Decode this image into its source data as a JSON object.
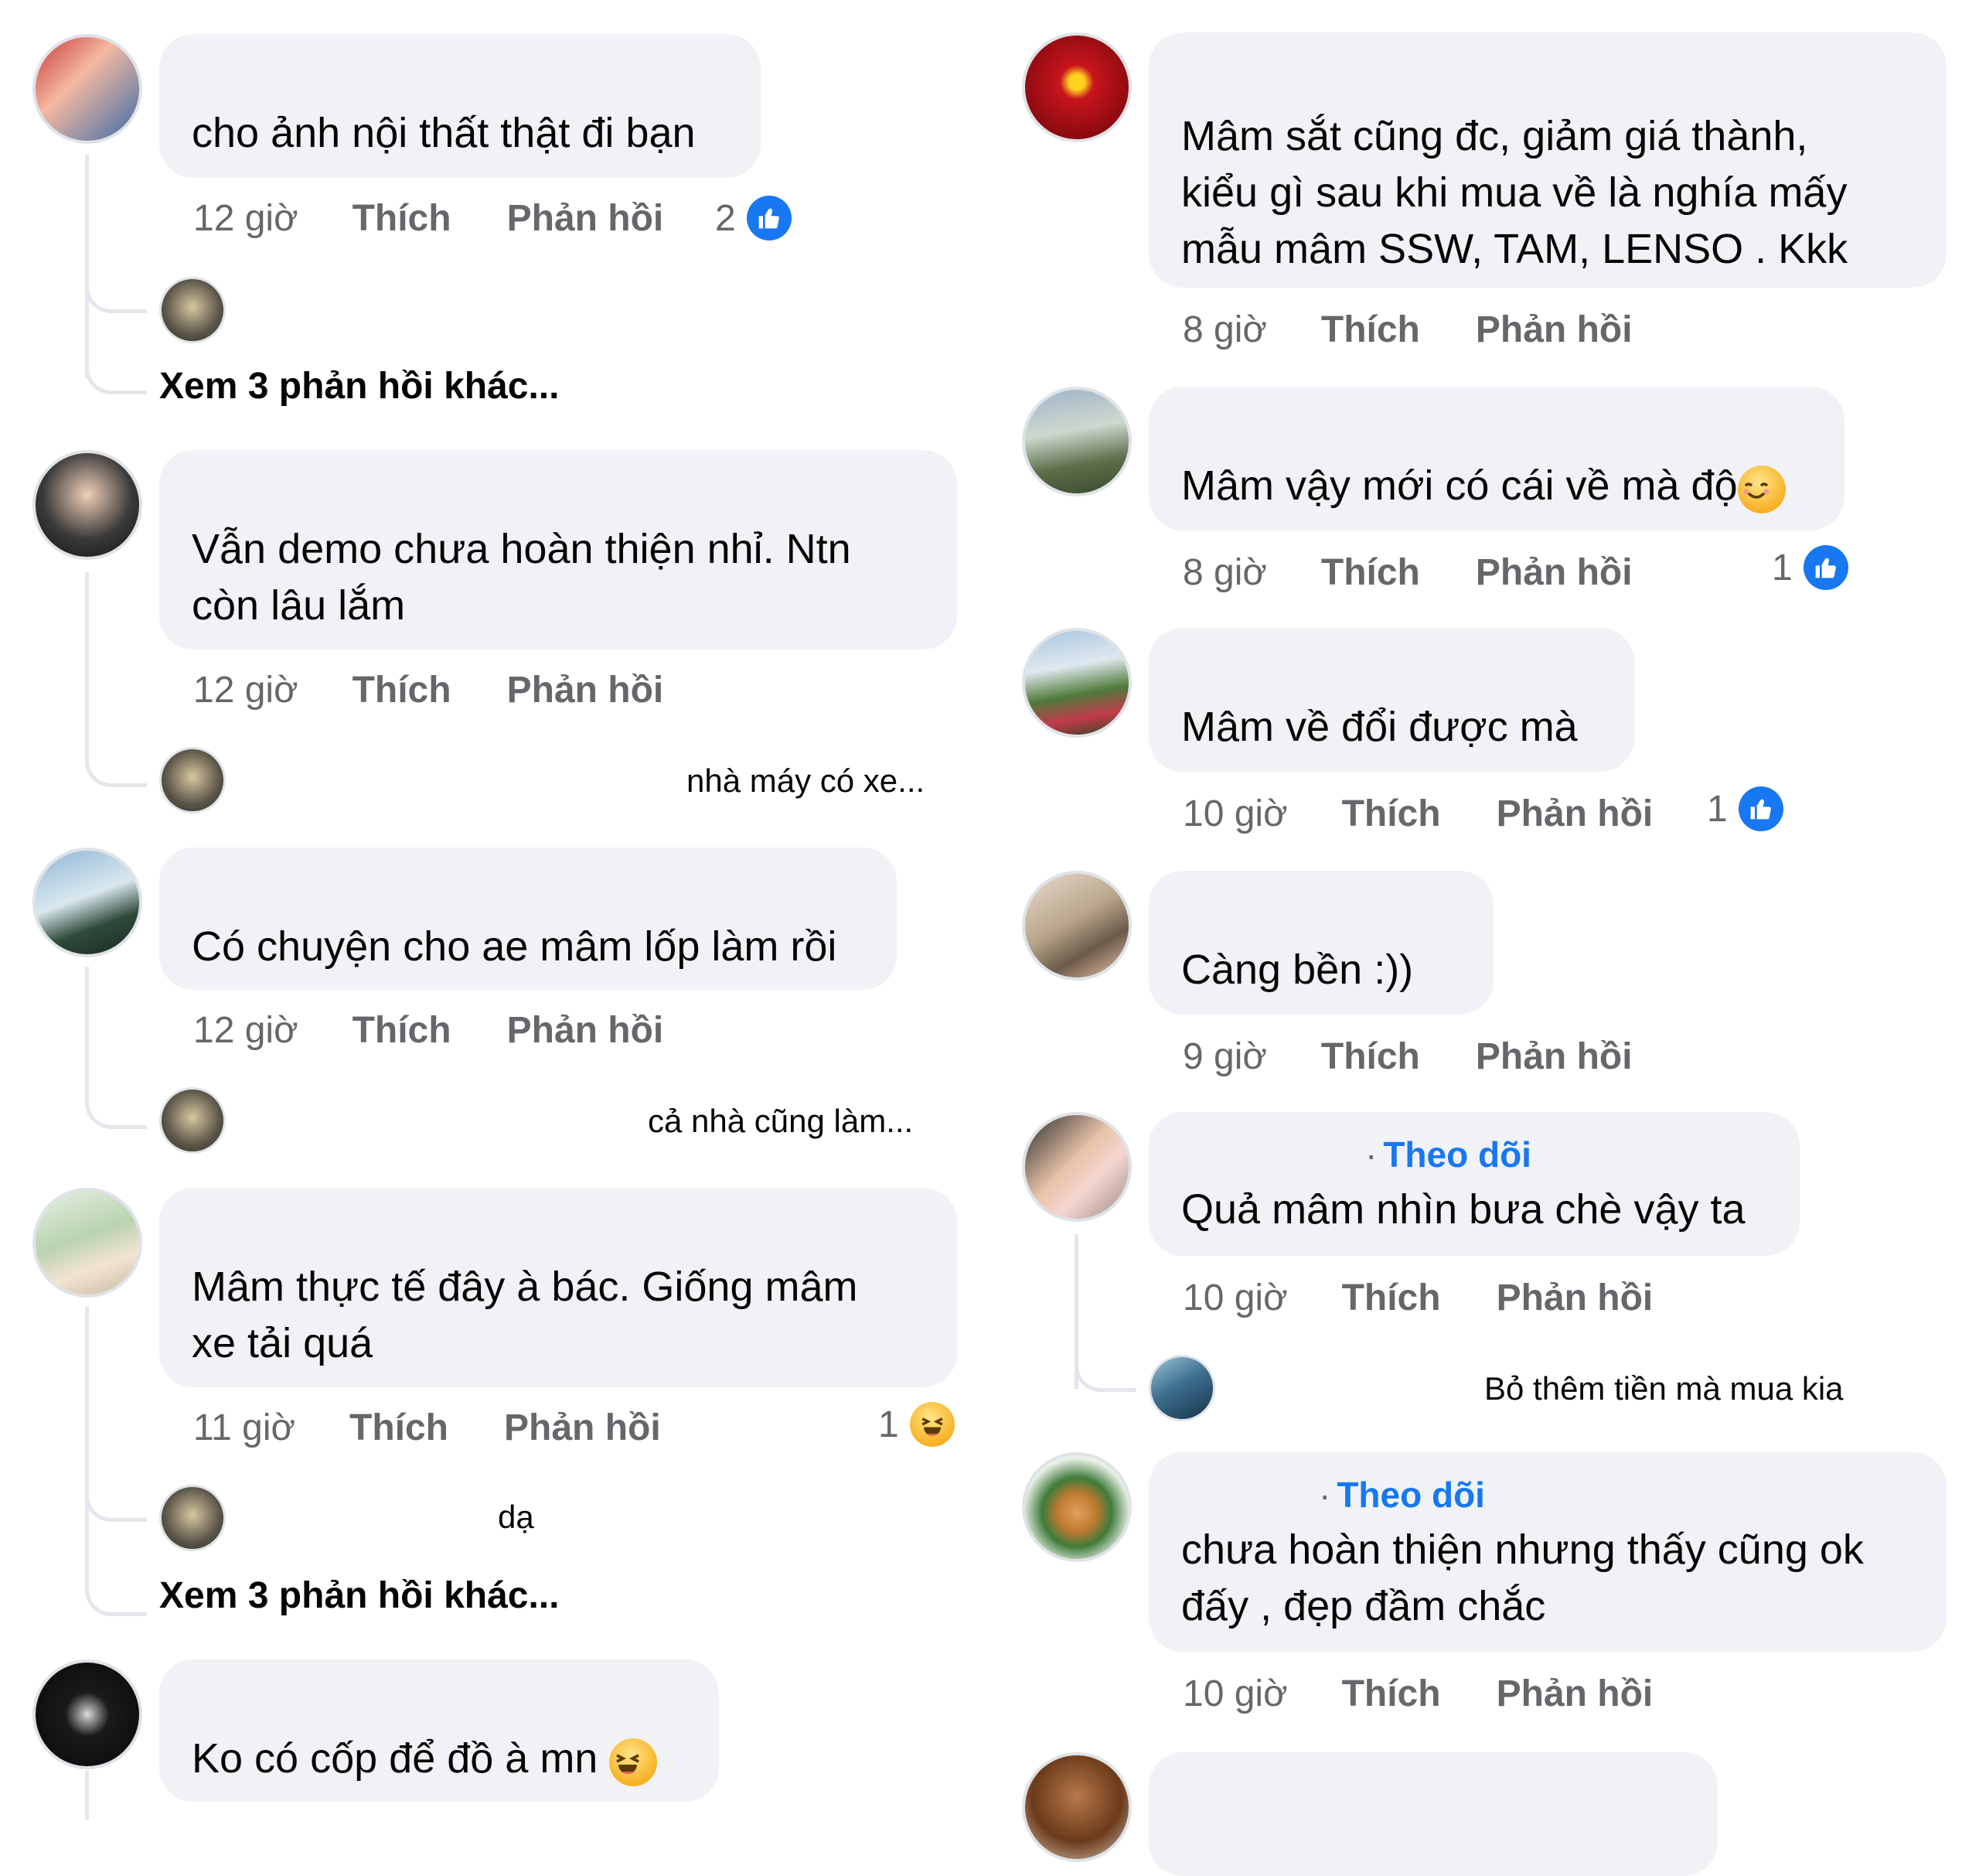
{
  "left": {
    "comments": [
      {
        "text": "cho ảnh nội thất thật đi bạn",
        "time": "12 giờ",
        "like": "Thích",
        "reply": "Phản hồi",
        "reaction_count": "2",
        "reaction": "like-icon",
        "reply_preview": "",
        "more": "Xem 3 phản hồi khác..."
      },
      {
        "text": "Vẫn demo chưa hoàn thiện nhỉ. Ntn\ncòn lâu lắm",
        "time": "12 giờ",
        "like": "Thích",
        "reply": "Phản hồi",
        "reply_preview": "nhà máy có xe..."
      },
      {
        "text": "Có chuyện cho ae mâm lốp làm rồi",
        "time": "12 giờ",
        "like": "Thích",
        "reply": "Phản hồi",
        "reply_preview": "cả nhà cũng làm..."
      },
      {
        "text": "Mâm thực tế đây à bác. Giống mâm\nxe tải quá",
        "time": "11 giờ",
        "like": "Thích",
        "reply": "Phản hồi",
        "reaction_count": "1",
        "reaction": "haha-icon",
        "reply_preview": "dạ",
        "more": "Xem 3 phản hồi khác..."
      },
      {
        "text": "Ko có cốp để đồ à mn"
      }
    ]
  },
  "right": {
    "comments": [
      {
        "text": "Mâm sắt cũng đc, giảm giá thành,\nkiểu gì sau khi mua về là nghía mấy\nmẫu mâm SSW, TAM, LENSO . Kkk",
        "time": "8 giờ",
        "like": "Thích",
        "reply": "Phản hồi"
      },
      {
        "text": "Mâm vậy mới có cái về mà độ",
        "time": "8 giờ",
        "like": "Thích",
        "reply": "Phản hồi",
        "reaction_count": "1",
        "reaction": "like-icon"
      },
      {
        "text": "Mâm về đổi được mà",
        "time": "10 giờ",
        "like": "Thích",
        "reply": "Phản hồi",
        "reaction_count": "1",
        "reaction": "like-icon"
      },
      {
        "text": "Càng bền :))",
        "time": "9 giờ",
        "like": "Thích",
        "reply": "Phản hồi"
      },
      {
        "follow": "Theo dõi",
        "text": "Quả mâm nhìn bưa chè vậy ta",
        "time": "10 giờ",
        "like": "Thích",
        "reply": "Phản hồi",
        "reply_preview": "Bỏ thêm tiền mà mua kia"
      },
      {
        "follow": "Theo dõi",
        "text": "chưa hoàn thiện nhưng thấy cũng ok\nđấy , đẹp đầm chắc",
        "time": "10 giờ",
        "like": "Thích",
        "reply": "Phản hồi"
      }
    ]
  },
  "colors": {
    "bubble": "#f0f2f5",
    "meta": "#65676b",
    "link": "#1877f2",
    "thread": "#e4e6eb"
  }
}
